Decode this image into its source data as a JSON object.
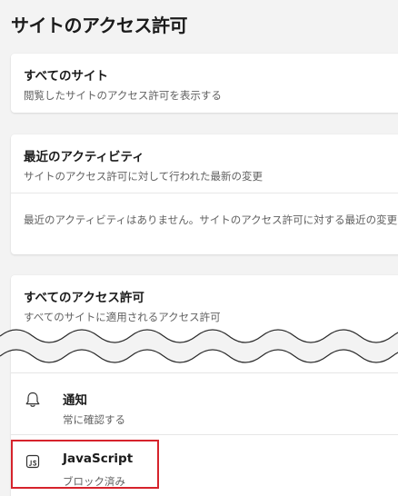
{
  "page": {
    "title": "サイトのアクセス許可"
  },
  "all_sites": {
    "title": "すべてのサイト",
    "subtitle": "閲覧したサイトのアクセス許可を表示する"
  },
  "recent_activity": {
    "title": "最近のアクティビティ",
    "subtitle": "サイトのアクセス許可に対して行われた最新の変更",
    "empty_text": "最近のアクティビティはありません。サイトのアクセス許可に対する最近の変更がここに表示されます"
  },
  "all_permissions": {
    "title": "すべてのアクセス許可",
    "subtitle": "すべてのサイトに適用されるアクセス許可",
    "items": [
      {
        "icon": "bell-icon",
        "name": "通知",
        "status": "常に確認する"
      },
      {
        "icon": "javascript-icon",
        "name": "JavaScript",
        "status": "ブロック済み"
      }
    ]
  },
  "colors": {
    "background": "#f3f3f3",
    "card": "#ffffff",
    "highlight": "#d6232c",
    "secondary_text": "#616161"
  }
}
